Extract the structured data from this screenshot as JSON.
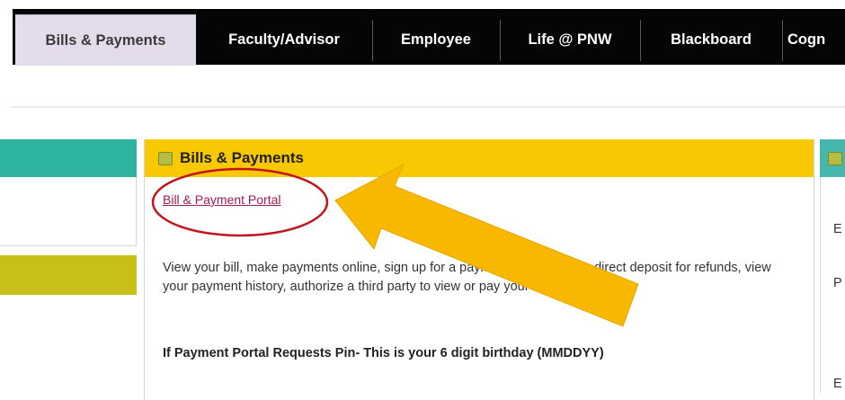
{
  "tabs": [
    {
      "label": "Bills & Payments",
      "active": true
    },
    {
      "label": "Faculty/Advisor",
      "active": false
    },
    {
      "label": "Employee",
      "active": false
    },
    {
      "label": "Life @ PNW",
      "active": false
    },
    {
      "label": "Blackboard",
      "active": false
    },
    {
      "label": "Cogn",
      "active": false
    }
  ],
  "main_portlet": {
    "title": "Bills & Payments",
    "link_label": "Bill & Payment Portal",
    "description": "View your bill, make payments online, sign up for a payment plan, enroll in direct deposit for refunds, view your payment history, authorize a third party to view or pay your account",
    "note": "If Payment Portal Requests Pin- This is your 6 digit birthday (MMDDYY)"
  },
  "right_portlet": {
    "lines": [
      "E",
      "P",
      "E"
    ]
  },
  "colors": {
    "tab_bar": "#050505",
    "active_tab": "#e4dcea",
    "portlet_header_yellow": "#f8c903",
    "left_teal": "#2db39e",
    "left_olive": "#c8c018",
    "right_teal": "#46b7ad",
    "link": "#9b1c57",
    "annotation_arrow": "#f8b800",
    "annotation_circle": "#c0161e"
  },
  "annotations": {
    "arrow_icon": "arrow-pointing-left-up",
    "circle_icon": "red-ellipse-highlight"
  }
}
